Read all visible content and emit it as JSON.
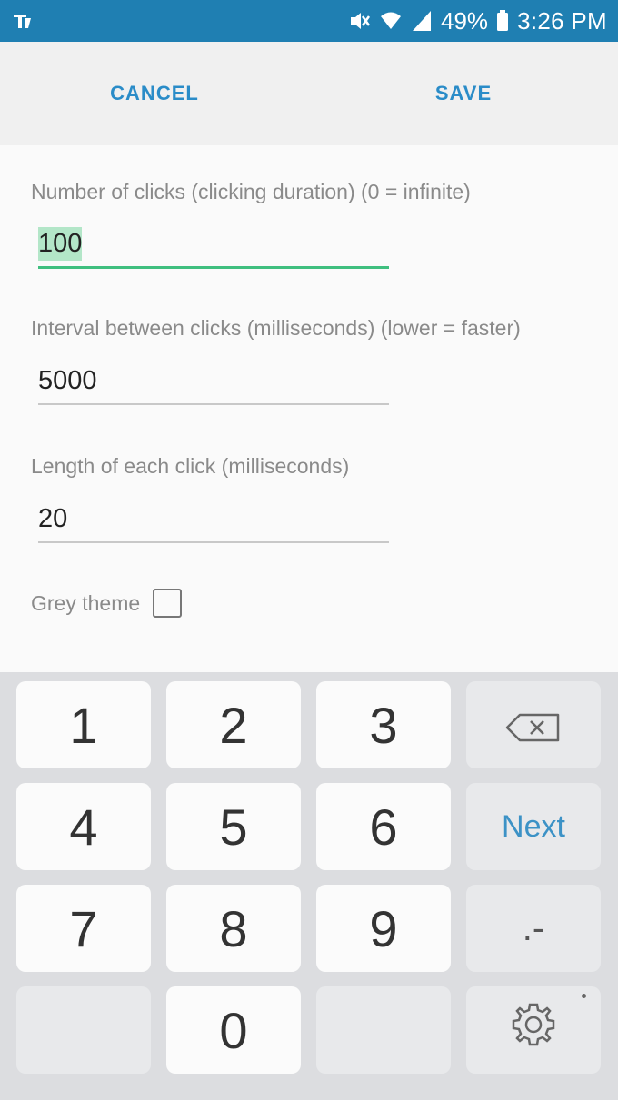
{
  "status_bar": {
    "battery": "49%",
    "time": "3:26 PM"
  },
  "action_bar": {
    "cancel_label": "CANCEL",
    "save_label": "SAVE"
  },
  "form": {
    "fields": [
      {
        "label": "Number of clicks (clicking duration) (0 = infinite)",
        "value": "100"
      },
      {
        "label": "Interval between clicks (milliseconds) (lower = faster)",
        "value": "5000"
      },
      {
        "label": "Length of each click (milliseconds)",
        "value": "20"
      }
    ],
    "grey_theme_label": "Grey theme",
    "grey_theme_checked": false
  },
  "keyboard": {
    "keys": {
      "k1": "1",
      "k2": "2",
      "k3": "3",
      "k4": "4",
      "k5": "5",
      "k6": "6",
      "k7": "7",
      "k8": "8",
      "k9": "9",
      "k0": "0",
      "next": "Next",
      "punct": ".-"
    }
  },
  "colors": {
    "status_bar": "#1f7fb2",
    "accent": "#2a8cc8",
    "active_underline": "#3fbf7f"
  }
}
